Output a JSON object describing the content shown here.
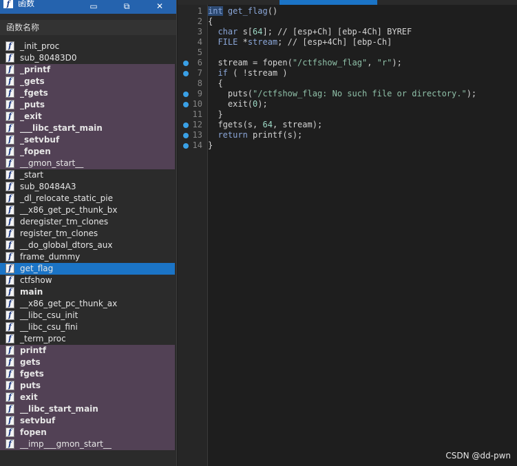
{
  "functions_window": {
    "title": "函数",
    "column_header": "函数名称",
    "icon_glyph": "f",
    "items": [
      {
        "name": "_init_proc",
        "kind": "normal",
        "bold": false
      },
      {
        "name": "sub_80483D0",
        "kind": "normal",
        "bold": false
      },
      {
        "name": "_printf",
        "kind": "lib",
        "bold": true
      },
      {
        "name": "_gets",
        "kind": "lib",
        "bold": true
      },
      {
        "name": "_fgets",
        "kind": "lib",
        "bold": true
      },
      {
        "name": "_puts",
        "kind": "lib",
        "bold": true
      },
      {
        "name": "_exit",
        "kind": "lib",
        "bold": true
      },
      {
        "name": "___libc_start_main",
        "kind": "lib",
        "bold": true
      },
      {
        "name": "_setvbuf",
        "kind": "lib",
        "bold": true
      },
      {
        "name": "_fopen",
        "kind": "lib",
        "bold": true
      },
      {
        "name": "__gmon_start__",
        "kind": "lib",
        "bold": false
      },
      {
        "name": "_start",
        "kind": "normal",
        "bold": false
      },
      {
        "name": "sub_80484A3",
        "kind": "normal",
        "bold": false
      },
      {
        "name": "_dl_relocate_static_pie",
        "kind": "normal",
        "bold": false
      },
      {
        "name": "__x86_get_pc_thunk_bx",
        "kind": "normal",
        "bold": false
      },
      {
        "name": "deregister_tm_clones",
        "kind": "normal",
        "bold": false
      },
      {
        "name": "register_tm_clones",
        "kind": "normal",
        "bold": false
      },
      {
        "name": "__do_global_dtors_aux",
        "kind": "normal",
        "bold": false
      },
      {
        "name": "frame_dummy",
        "kind": "normal",
        "bold": false
      },
      {
        "name": "get_flag",
        "kind": "selected",
        "bold": false
      },
      {
        "name": "ctfshow",
        "kind": "normal",
        "bold": false
      },
      {
        "name": "main",
        "kind": "normal",
        "bold": true
      },
      {
        "name": "__x86_get_pc_thunk_ax",
        "kind": "normal",
        "bold": false
      },
      {
        "name": "__libc_csu_init",
        "kind": "normal",
        "bold": false
      },
      {
        "name": "__libc_csu_fini",
        "kind": "normal",
        "bold": false
      },
      {
        "name": "_term_proc",
        "kind": "normal",
        "bold": false
      },
      {
        "name": "printf",
        "kind": "lib",
        "bold": true
      },
      {
        "name": "gets",
        "kind": "lib",
        "bold": true
      },
      {
        "name": "fgets",
        "kind": "lib",
        "bold": true
      },
      {
        "name": "puts",
        "kind": "lib",
        "bold": true
      },
      {
        "name": "exit",
        "kind": "lib",
        "bold": true
      },
      {
        "name": "__libc_start_main",
        "kind": "lib",
        "bold": true
      },
      {
        "name": "setvbuf",
        "kind": "lib",
        "bold": true
      },
      {
        "name": "fopen",
        "kind": "lib",
        "bold": true
      },
      {
        "name": "__imp___gmon_start__",
        "kind": "lib",
        "bold": false
      }
    ]
  },
  "pseudocode": {
    "lines": [
      {
        "n": "1",
        "bp": false,
        "tokens": [
          [
            "hl kw",
            "int"
          ],
          [
            "",
            ""
          ],
          [
            "kw",
            " get_flag"
          ],
          [
            "",
            "()"
          ]
        ]
      },
      {
        "n": "2",
        "bp": false,
        "tokens": [
          [
            "",
            "{"
          ]
        ]
      },
      {
        "n": "3",
        "bp": false,
        "tokens": [
          [
            "ty",
            "  char"
          ],
          [
            "",
            " s["
          ],
          [
            "num",
            "64"
          ],
          [
            "",
            "]; // [esp+Ch] [ebp-4Ch] BYREF"
          ]
        ]
      },
      {
        "n": "4",
        "bp": false,
        "tokens": [
          [
            "ty",
            "  FILE"
          ],
          [
            "",
            " *"
          ],
          [
            "kw",
            "stream"
          ],
          [
            "",
            "; // [esp+4Ch] [ebp-Ch]"
          ]
        ]
      },
      {
        "n": "5",
        "bp": false,
        "tokens": [
          [
            "",
            ""
          ]
        ]
      },
      {
        "n": "6",
        "bp": true,
        "tokens": [
          [
            "",
            "  stream = fopen("
          ],
          [
            "str",
            "\"/ctfshow_flag\""
          ],
          [
            "",
            ", "
          ],
          [
            "str",
            "\"r\""
          ],
          [
            "",
            ");"
          ]
        ]
      },
      {
        "n": "7",
        "bp": true,
        "tokens": [
          [
            "kw",
            "  if"
          ],
          [
            "",
            " ( !stream )"
          ]
        ]
      },
      {
        "n": "8",
        "bp": false,
        "tokens": [
          [
            "",
            "  {"
          ]
        ]
      },
      {
        "n": "9",
        "bp": true,
        "tokens": [
          [
            "",
            "    puts("
          ],
          [
            "str",
            "\"/ctfshow_flag: No such file or directory.\""
          ],
          [
            "",
            ");"
          ]
        ]
      },
      {
        "n": "10",
        "bp": true,
        "tokens": [
          [
            "",
            "    exit("
          ],
          [
            "num",
            "0"
          ],
          [
            "",
            ");"
          ]
        ]
      },
      {
        "n": "11",
        "bp": false,
        "tokens": [
          [
            "",
            "  }"
          ]
        ]
      },
      {
        "n": "12",
        "bp": true,
        "tokens": [
          [
            "",
            "  fgets(s, "
          ],
          [
            "num",
            "64"
          ],
          [
            "",
            ", stream);"
          ]
        ]
      },
      {
        "n": "13",
        "bp": true,
        "tokens": [
          [
            "kw",
            "  return"
          ],
          [
            "",
            " printf(s);"
          ]
        ]
      },
      {
        "n": "14",
        "bp": true,
        "tokens": [
          [
            "",
            "}"
          ]
        ]
      }
    ]
  },
  "watermark": "CSDN @dd-pwn",
  "colors": {
    "selection": "#1b74c6",
    "library_row": "#524155",
    "title_bar": "#2563ae",
    "breakpoint": "#3aa0e6"
  }
}
